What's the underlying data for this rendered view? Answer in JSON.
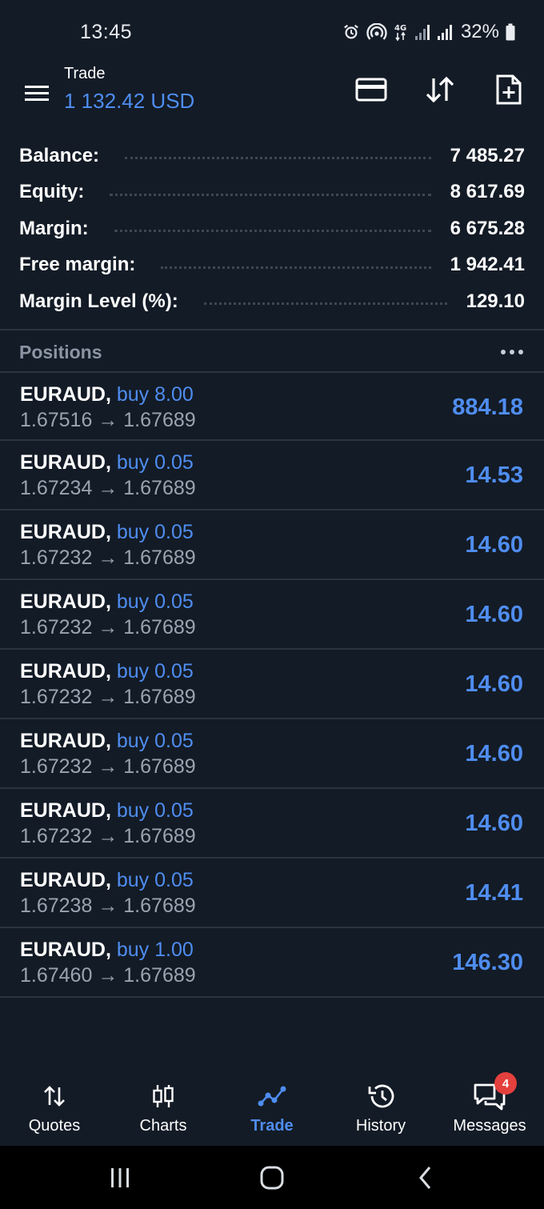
{
  "status_bar": {
    "time": "13:45",
    "battery": "32%",
    "icons": [
      "alarm-icon",
      "hotspot-icon",
      "network-4g-icon",
      "signal-icon",
      "signal-icon",
      "battery-icon"
    ]
  },
  "header": {
    "title": "Trade",
    "subtitle": "1 132.42 USD",
    "actions": [
      "card-icon",
      "sort-icon",
      "new-document-icon"
    ]
  },
  "summary": {
    "rows": [
      {
        "label": "Balance:",
        "value": "7 485.27"
      },
      {
        "label": "Equity:",
        "value": "8 617.69"
      },
      {
        "label": "Margin:",
        "value": "6 675.28"
      },
      {
        "label": "Free margin:",
        "value": "1 942.41"
      },
      {
        "label": "Margin Level (%):",
        "value": "129.10"
      }
    ]
  },
  "positions": {
    "title": "Positions",
    "rows": [
      {
        "symbol": "EURAUD,",
        "side": "buy 8.00",
        "open": "1.67516",
        "current": "1.67689",
        "profit": "884.18"
      },
      {
        "symbol": "EURAUD,",
        "side": "buy 0.05",
        "open": "1.67234",
        "current": "1.67689",
        "profit": "14.53"
      },
      {
        "symbol": "EURAUD,",
        "side": "buy 0.05",
        "open": "1.67232",
        "current": "1.67689",
        "profit": "14.60"
      },
      {
        "symbol": "EURAUD,",
        "side": "buy 0.05",
        "open": "1.67232",
        "current": "1.67689",
        "profit": "14.60"
      },
      {
        "symbol": "EURAUD,",
        "side": "buy 0.05",
        "open": "1.67232",
        "current": "1.67689",
        "profit": "14.60"
      },
      {
        "symbol": "EURAUD,",
        "side": "buy 0.05",
        "open": "1.67232",
        "current": "1.67689",
        "profit": "14.60"
      },
      {
        "symbol": "EURAUD,",
        "side": "buy 0.05",
        "open": "1.67232",
        "current": "1.67689",
        "profit": "14.60"
      },
      {
        "symbol": "EURAUD,",
        "side": "buy 0.05",
        "open": "1.67238",
        "current": "1.67689",
        "profit": "14.41"
      },
      {
        "symbol": "EURAUD,",
        "side": "buy 1.00",
        "open": "1.67460",
        "current": "1.67689",
        "profit": "146.30"
      }
    ]
  },
  "bottom_nav": {
    "items": [
      {
        "label": "Quotes",
        "icon": "quotes-icon"
      },
      {
        "label": "Charts",
        "icon": "candlestick-icon"
      },
      {
        "label": "Trade",
        "icon": "trade-icon",
        "active": true
      },
      {
        "label": "History",
        "icon": "history-icon"
      },
      {
        "label": "Messages",
        "icon": "messages-icon",
        "badge": "4"
      }
    ]
  },
  "system_nav": [
    "recents-icon",
    "home-icon",
    "back-icon"
  ],
  "colors": {
    "background": "#131b26",
    "accent": "#4f8df0",
    "divider": "#2a333f",
    "muted_text": "#9aa4b1",
    "badge": "#e4403d"
  }
}
